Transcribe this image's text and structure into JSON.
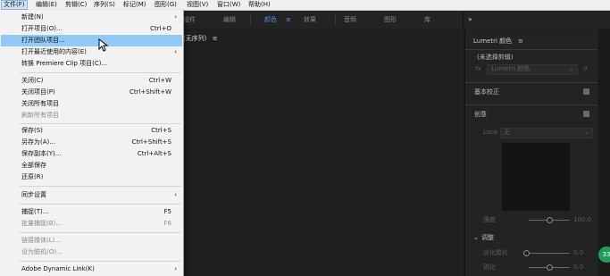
{
  "menubar": {
    "items": [
      "文件(F)",
      "编辑(E)",
      "剪辑(C)",
      "序列(S)",
      "标记(M)",
      "图形(G)",
      "视图(V)",
      "窗口(W)",
      "帮助(H)"
    ]
  },
  "workspaces": {
    "items": [
      "组件",
      "编辑",
      "颜色",
      "效果",
      "音频",
      "图形",
      "库"
    ],
    "active_menu_glyph": "≡",
    "overflow": "»"
  },
  "sequence_panel": {
    "title": "(无序列)",
    "menu_glyph": "≡"
  },
  "lumetri": {
    "title": "Lumetri 颜色",
    "menu_glyph": "≡",
    "clip_label": "(未选择剪辑)",
    "fx_label": "fx",
    "fx_value": "Lumetri 颜色",
    "reset_glyph": "↺",
    "basic_correction": "基本校正",
    "creative": "创意",
    "look_label": "Look",
    "look_value": "无",
    "intensity_label": "强度",
    "intensity_value": "100.0",
    "adjustments": "调整",
    "faded_film_label": "淡化胶片",
    "faded_film_value": "0.0",
    "sharpen_label": "锐化",
    "sharpen_value": "0.0",
    "chevron": "⌄"
  },
  "badge": {
    "text": "33"
  },
  "file_menu": {
    "items": [
      {
        "label": "新建(N)",
        "shortcut": "",
        "submenu": true,
        "disabled": false
      },
      {
        "label": "打开项目(O)...",
        "shortcut": "Ctrl+O",
        "submenu": false,
        "disabled": false
      },
      {
        "label": "打开团队项目...",
        "shortcut": "",
        "submenu": false,
        "disabled": false,
        "highlighted": true
      },
      {
        "label": "打开最近使用的内容(E)",
        "shortcut": "",
        "submenu": true,
        "disabled": false
      },
      {
        "label": "转换 Premiere Clip 项目(C)...",
        "shortcut": "",
        "submenu": false,
        "disabled": false
      },
      {
        "label": "关闭(C)",
        "shortcut": "Ctrl+W",
        "submenu": false,
        "disabled": false
      },
      {
        "label": "关闭项目(P)",
        "shortcut": "Ctrl+Shift+W",
        "submenu": false,
        "disabled": false
      },
      {
        "label": "关闭所有项目",
        "shortcut": "",
        "submenu": false,
        "disabled": false
      },
      {
        "label": "刷新所有项目",
        "shortcut": "",
        "submenu": false,
        "disabled": true
      },
      {
        "label": "保存(S)",
        "shortcut": "Ctrl+S",
        "submenu": false,
        "disabled": false
      },
      {
        "label": "另存为(A)...",
        "shortcut": "Ctrl+Shift+S",
        "submenu": false,
        "disabled": false
      },
      {
        "label": "保存副本(Y)...",
        "shortcut": "Ctrl+Alt+S",
        "submenu": false,
        "disabled": false
      },
      {
        "label": "全部保存",
        "shortcut": "",
        "submenu": false,
        "disabled": false
      },
      {
        "label": "还原(R)",
        "shortcut": "",
        "submenu": false,
        "disabled": false
      },
      {
        "label": "同步设置",
        "shortcut": "",
        "submenu": true,
        "disabled": false
      },
      {
        "label": "捕捉(T)...",
        "shortcut": "F5",
        "submenu": false,
        "disabled": false
      },
      {
        "label": "批量捕捉(B)...",
        "shortcut": "F6",
        "submenu": false,
        "disabled": true
      },
      {
        "label": "链接媒体(L)...",
        "shortcut": "",
        "submenu": false,
        "disabled": true
      },
      {
        "label": "设为脱机(O)...",
        "shortcut": "",
        "submenu": false,
        "disabled": true
      },
      {
        "label": "Adobe Dynamic Link(K)",
        "shortcut": "",
        "submenu": true,
        "disabled": false
      }
    ],
    "submenu_glyph": "›"
  },
  "colors": {
    "accent_blue": "#4d8fe0",
    "menu_highlight": "#91c9f7",
    "badge_green": "#1f9e57"
  }
}
